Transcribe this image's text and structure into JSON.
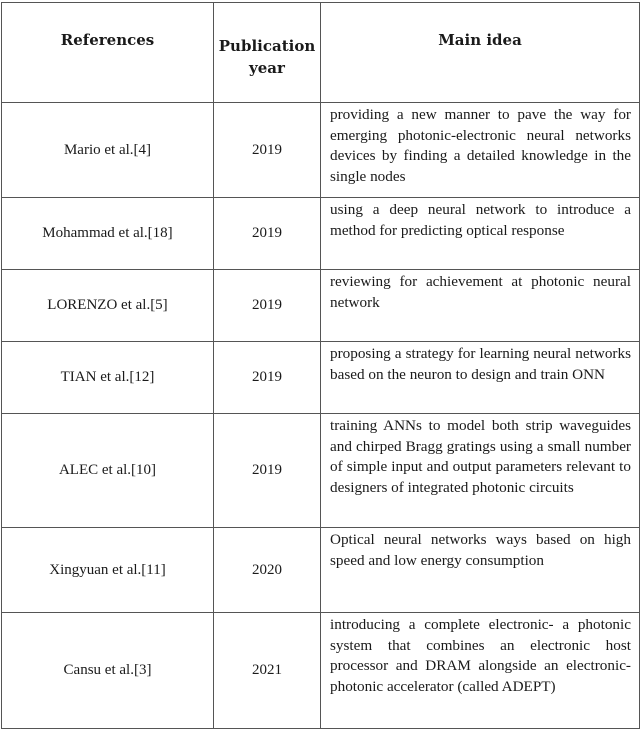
{
  "table": {
    "headers": {
      "references": "References",
      "publication_year_line1": "Publication",
      "publication_year_line2": "year",
      "main_idea": "Main idea"
    },
    "rows": [
      {
        "reference": "Mario et al.[4]",
        "year": "2019",
        "main_idea": "providing a new manner to pave the way for emerging photonic-electronic neural networks devices by finding a detailed knowledge in the single nodes"
      },
      {
        "reference": "Mohammad et al.[18]",
        "year": "2019",
        "main_idea": "using a deep neural network to introduce a method for predicting optical response"
      },
      {
        "reference": "LORENZO et al.[5]",
        "year": "2019",
        "main_idea": "reviewing for achievement at photonic neural network"
      },
      {
        "reference": "TIAN et al.[12]",
        "year": "2019",
        "main_idea": "proposing a strategy for learning neural networks based on the neuron to design and train ONN"
      },
      {
        "reference": "ALEC et al.[10]",
        "year": "2019",
        "main_idea": "training ANNs to model both strip waveg­uides and chirped Bragg gratings using a small number of simple input and output parameters relevant to designers of inte­grated photonic circuits"
      },
      {
        "reference": "Xingyuan et al.[11]",
        "year": "2020",
        "main_idea": "Optical neural networks ways based on high speed and low energy consumption"
      },
      {
        "reference": "Cansu et al.[3]",
        "year": "2021",
        "main_idea": "introducing a complete electronic- a pho­tonic system that combines an electronic host processor and DRAM alongside an electronic-photonic accelerator (called ADEPT)"
      }
    ]
  }
}
